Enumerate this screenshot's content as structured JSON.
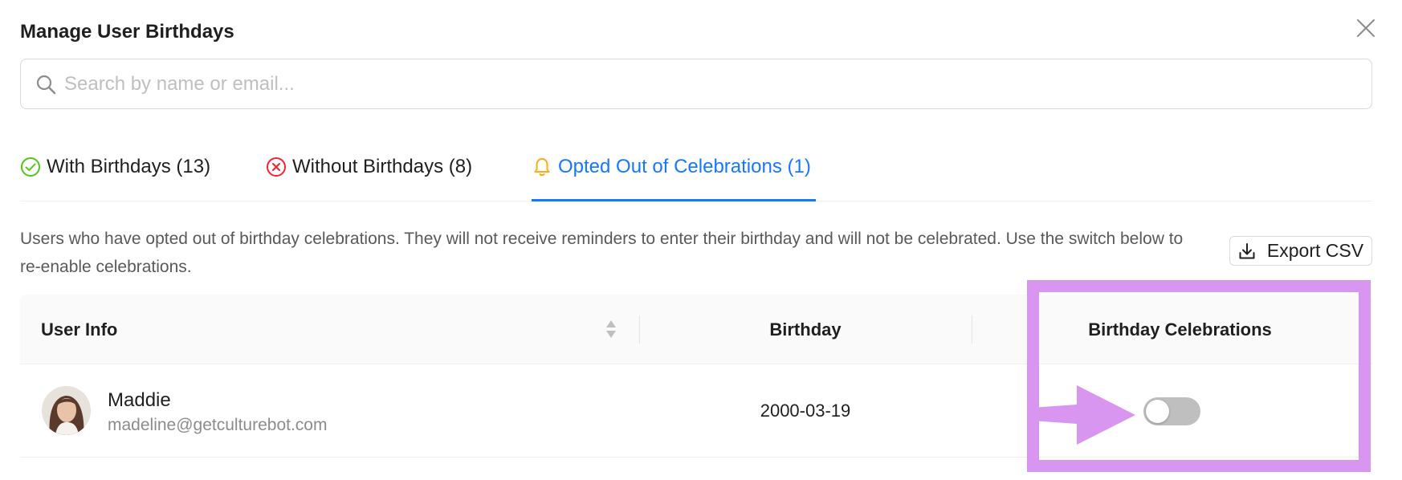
{
  "modal": {
    "title": "Manage User Birthdays"
  },
  "search": {
    "placeholder": "Search by name or email...",
    "value": ""
  },
  "tabs": [
    {
      "label": "With Birthdays (13)",
      "icon": "check-circle-icon",
      "color": "#52c41a",
      "active": false
    },
    {
      "label": "Without Birthdays (8)",
      "icon": "x-circle-icon",
      "color": "#f5222d",
      "active": false
    },
    {
      "label": "Opted Out of Celebrations (1)",
      "icon": "bell-icon",
      "color": "#faad14",
      "active": true
    }
  ],
  "description": "Users who have opted out of birthday celebrations. They will not receive reminders to enter their birthday and will not be celebrated. Use the switch below to re-enable celebrations.",
  "export": {
    "label": "Export CSV",
    "icon": "download-icon"
  },
  "table": {
    "columns": [
      "User Info",
      "Birthday",
      "Birthday Celebrations"
    ],
    "rows": [
      {
        "name": "Maddie",
        "email": "madeline@getculturebot.com",
        "birthday": "2000-03-19",
        "celebrations_enabled": false
      }
    ]
  },
  "colors": {
    "accent": "#1677ff",
    "highlight": "#d896f0"
  }
}
